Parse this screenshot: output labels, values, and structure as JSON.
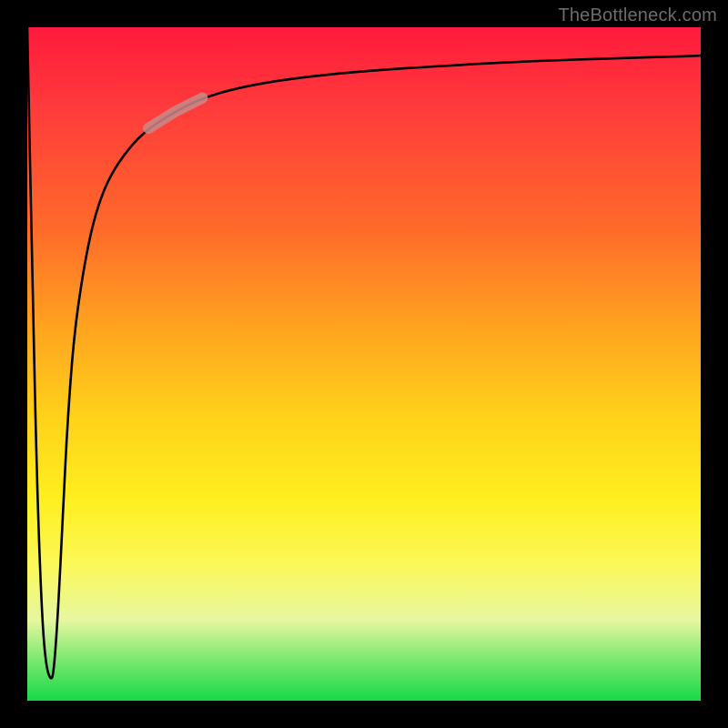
{
  "attribution": "TheBottleneck.com",
  "chart_data": {
    "type": "line",
    "title": "",
    "xlabel": "",
    "ylabel": "",
    "xlim": [
      0,
      100
    ],
    "ylim": [
      0,
      100
    ],
    "series": [
      {
        "name": "curve",
        "x": [
          0.0,
          0.8,
          1.5,
          2.2,
          2.8,
          3.5,
          3.9,
          4.5,
          5.3,
          6.0,
          7.0,
          8.5,
          10.0,
          12.0,
          15.0,
          18.0,
          22.0,
          26.0,
          32.0,
          40.0,
          50.0,
          62.0,
          75.0,
          88.0,
          100.0
        ],
        "y": [
          100.0,
          60.0,
          30.0,
          12.0,
          5.0,
          3.0,
          4.0,
          12.0,
          28.0,
          42.0,
          55.0,
          65.0,
          72.0,
          77.5,
          82.0,
          85.0,
          87.5,
          89.5,
          91.2,
          92.5,
          93.5,
          94.3,
          95.0,
          95.4,
          95.8
        ]
      }
    ],
    "highlight_segment": {
      "x_start": 18.0,
      "x_end": 26.0
    },
    "gradient_stops": [
      {
        "pos": 0.0,
        "color": "#ff1a3c"
      },
      {
        "pos": 0.3,
        "color": "#ff6a2a"
      },
      {
        "pos": 0.58,
        "color": "#ffd21a"
      },
      {
        "pos": 0.8,
        "color": "#fbf85a"
      },
      {
        "pos": 0.94,
        "color": "#7ae86f"
      },
      {
        "pos": 1.0,
        "color": "#17d948"
      }
    ]
  }
}
